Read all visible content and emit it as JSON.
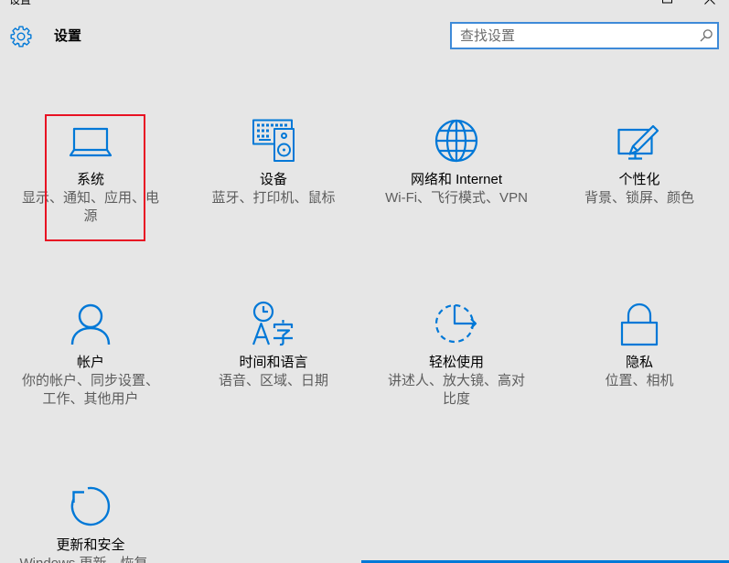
{
  "window": {
    "title": "设置",
    "controls": [
      "maximize-icon",
      "close-icon"
    ]
  },
  "header": {
    "icon": "gear-icon",
    "title": "设置"
  },
  "search": {
    "placeholder": "查找设置",
    "value": "",
    "icon": "search-icon"
  },
  "colors": {
    "accent": "#0078d7",
    "background": "#e6e6e6",
    "text": "#000000",
    "description": "#5d5d5d",
    "highlight": "#e81123",
    "search_border": "#3e8ad8",
    "muted": "#6d6d6d"
  },
  "categories": [
    {
      "label": "系统",
      "description": "显示、通知、应用、电源",
      "icon": "laptop-icon",
      "highlighted": true
    },
    {
      "label": "设备",
      "description": "蓝牙、打印机、鼠标",
      "icon": "devices-icon"
    },
    {
      "label": "网络和 Internet",
      "description": "Wi-Fi、飞行模式、VPN",
      "icon": "globe-icon"
    },
    {
      "label": "个性化",
      "description": "背景、锁屏、颜色",
      "icon": "personalization-icon"
    },
    {
      "label": "帐户",
      "description": "你的帐户、同步设置、工作、其他用户",
      "icon": "person-icon"
    },
    {
      "label": "时间和语言",
      "description": "语音、区域、日期",
      "icon": "time-language-icon"
    },
    {
      "label": "轻松使用",
      "description": "讲述人、放大镜、高对比度",
      "icon": "ease-of-access-icon"
    },
    {
      "label": "隐私",
      "description": "位置、相机",
      "icon": "lock-icon"
    },
    {
      "label": "更新和安全",
      "description": "Windows 更新、恢复、备份",
      "icon": "update-icon"
    }
  ]
}
